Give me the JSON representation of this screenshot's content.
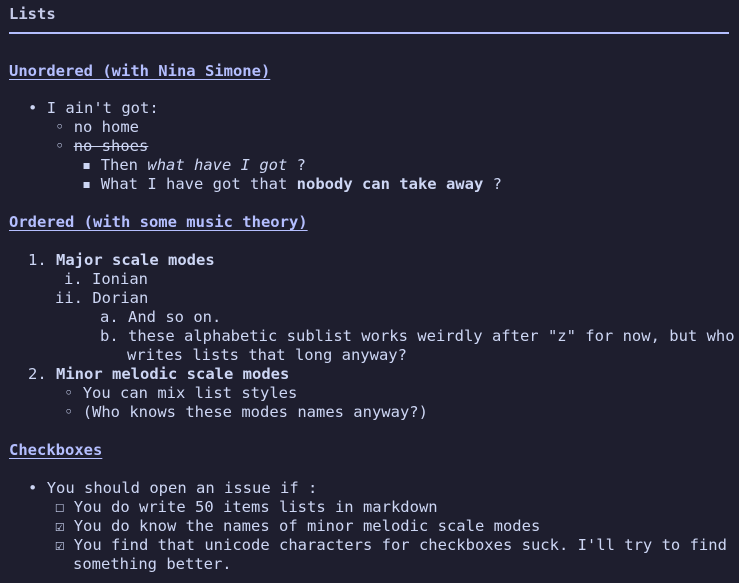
{
  "title": "Lists",
  "unordered": {
    "heading": "Unordered (with Nina Simone)",
    "item1": "I ain't got:",
    "item1a": "no home",
    "item1b": "no shoes",
    "item1b1_pre": "Then ",
    "item1b1_em": "what have I got",
    "item1b1_post": " ?",
    "item1b2_pre": "What I have got that ",
    "item1b2_strong": "nobody can take away",
    "item1b2_post": " ?"
  },
  "ordered": {
    "heading": "Ordered (with some music theory)",
    "item1": "Major scale modes",
    "item1i": "Ionian",
    "item1ii": "Dorian",
    "item1ii_a": "And so on.",
    "item1ii_b_line1": "these alphabetic sublist works weirdly after \"z\" for now, but who",
    "item1ii_b_line2": "writes lists that long anyway?",
    "item2": "Minor melodic scale modes",
    "item2a": "You can mix list styles",
    "item2b": "(Who knows these modes names anyway?)"
  },
  "checkboxes": {
    "heading": "Checkboxes",
    "item1": "You should open an issue if :",
    "cb1": "You do write 50 items lists in markdown",
    "cb2": "You do know the names of minor melodic scale modes",
    "cb3_line1": "You find that unicode characters for checkboxes suck. I'll try to find",
    "cb3_line2": "something better."
  },
  "markers": {
    "bullet": "•",
    "circle": "◦",
    "square": "▪",
    "num1": "1.",
    "num2": "2.",
    "roman1": "i.",
    "roman2": "ii.",
    "alpha_a": "a.",
    "alpha_b": "b.",
    "box_empty": "☐",
    "box_checked": "☑"
  },
  "colors": {
    "background": "#1e1e2e",
    "text": "#cdd6f4",
    "heading": "#b4befe"
  }
}
